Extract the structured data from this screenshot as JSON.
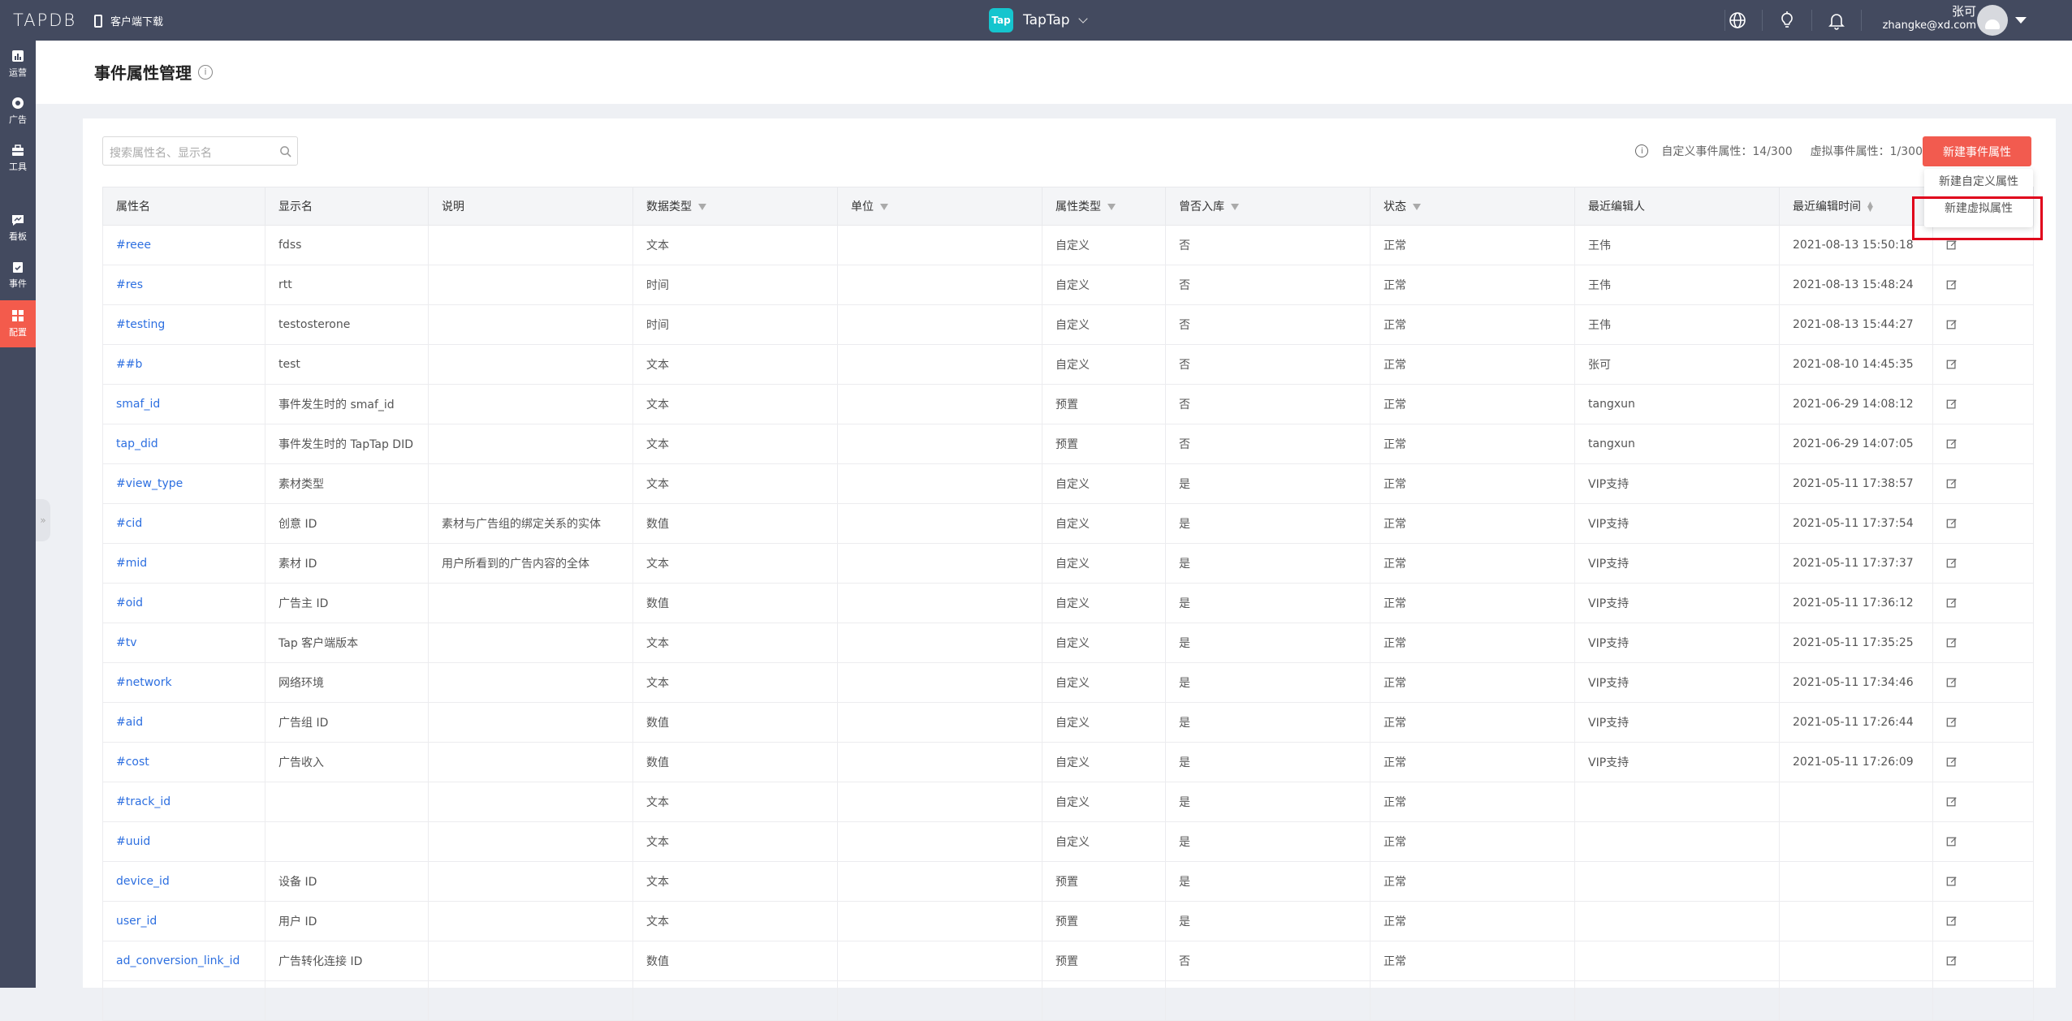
{
  "app": {
    "logo": "TAPDB",
    "download": "客户端下载",
    "name": "TapTap",
    "app_badge": "Tap",
    "user_name": "张可",
    "user_email": "zhangke@xd.com"
  },
  "sidebar": {
    "items": [
      {
        "label": "运营",
        "icon": "chart-icon"
      },
      {
        "label": "广告",
        "icon": "ad-icon"
      },
      {
        "label": "工具",
        "icon": "toolbox-icon"
      },
      {
        "label": "看板",
        "icon": "dashboard-icon"
      },
      {
        "label": "事件",
        "icon": "clipboard-icon"
      },
      {
        "label": "配置",
        "icon": "grid-icon"
      }
    ]
  },
  "page": {
    "title": "事件属性管理",
    "info": "i",
    "collapse": "»"
  },
  "toolbar": {
    "search_placeholder": "搜索属性名、显示名",
    "quota_custom": "自定义事件属性：14/300",
    "quota_virtual": "虚拟事件属性：1/300",
    "new_button": "新建事件属性"
  },
  "dropdown": {
    "items": [
      "新建自定义属性",
      "新建虚拟属性"
    ]
  },
  "table": {
    "columns": [
      "属性名",
      "显示名",
      "说明",
      "数据类型",
      "单位",
      "属性类型",
      "曾否入库",
      "状态",
      "最近编辑人",
      "最近编辑时间",
      ""
    ],
    "rows": [
      [
        "#reee",
        "fdss",
        "",
        "文本",
        "",
        "自定义",
        "否",
        "正常",
        "王伟",
        "2021-08-13 15:50:18"
      ],
      [
        "#res",
        "rtt",
        "",
        "时间",
        "",
        "自定义",
        "否",
        "正常",
        "王伟",
        "2021-08-13 15:48:24"
      ],
      [
        "#testing",
        "testosterone",
        "",
        "时间",
        "",
        "自定义",
        "否",
        "正常",
        "王伟",
        "2021-08-13 15:44:27"
      ],
      [
        "##b",
        "test",
        "",
        "文本",
        "",
        "自定义",
        "否",
        "正常",
        "张可",
        "2021-08-10 14:45:35"
      ],
      [
        "smaf_id",
        "事件发生时的 smaf_id",
        "",
        "文本",
        "",
        "预置",
        "否",
        "正常",
        "tangxun",
        "2021-06-29 14:08:12"
      ],
      [
        "tap_did",
        "事件发生时的 TapTap DID",
        "",
        "文本",
        "",
        "预置",
        "否",
        "正常",
        "tangxun",
        "2021-06-29 14:07:05"
      ],
      [
        "#view_type",
        "素材类型",
        "",
        "文本",
        "",
        "自定义",
        "是",
        "正常",
        "VIP支持",
        "2021-05-11 17:38:57"
      ],
      [
        "#cid",
        "创意 ID",
        "素材与广告组的绑定关系的实体",
        "数值",
        "",
        "自定义",
        "是",
        "正常",
        "VIP支持",
        "2021-05-11 17:37:54"
      ],
      [
        "#mid",
        "素材 ID",
        "用户所看到的广告内容的全体",
        "文本",
        "",
        "自定义",
        "是",
        "正常",
        "VIP支持",
        "2021-05-11 17:37:37"
      ],
      [
        "#oid",
        "广告主 ID",
        "",
        "数值",
        "",
        "自定义",
        "是",
        "正常",
        "VIP支持",
        "2021-05-11 17:36:12"
      ],
      [
        "#tv",
        "Tap 客户端版本",
        "",
        "文本",
        "",
        "自定义",
        "是",
        "正常",
        "VIP支持",
        "2021-05-11 17:35:25"
      ],
      [
        "#network",
        "网络环境",
        "",
        "文本",
        "",
        "自定义",
        "是",
        "正常",
        "VIP支持",
        "2021-05-11 17:34:46"
      ],
      [
        "#aid",
        "广告组 ID",
        "",
        "数值",
        "",
        "自定义",
        "是",
        "正常",
        "VIP支持",
        "2021-05-11 17:26:44"
      ],
      [
        "#cost",
        "广告收入",
        "",
        "数值",
        "",
        "自定义",
        "是",
        "正常",
        "VIP支持",
        "2021-05-11 17:26:09"
      ],
      [
        "#track_id",
        "",
        "",
        "文本",
        "",
        "自定义",
        "是",
        "正常",
        "",
        ""
      ],
      [
        "#uuid",
        "",
        "",
        "文本",
        "",
        "自定义",
        "是",
        "正常",
        "",
        ""
      ],
      [
        "device_id",
        "设备 ID",
        "",
        "文本",
        "",
        "预置",
        "是",
        "正常",
        "",
        ""
      ],
      [
        "user_id",
        "用户 ID",
        "",
        "文本",
        "",
        "预置",
        "是",
        "正常",
        "",
        ""
      ],
      [
        "ad_conversion_link_id",
        "广告转化连接 ID",
        "",
        "数值",
        "",
        "预置",
        "否",
        "正常",
        "",
        ""
      ],
      [
        "",
        "",
        "",
        "",
        "",
        "",
        "",
        "",
        "",
        ""
      ]
    ]
  },
  "colors": {
    "topbar": "#434a5f",
    "accent": "#f25b4f",
    "link": "#2d6fe0"
  }
}
